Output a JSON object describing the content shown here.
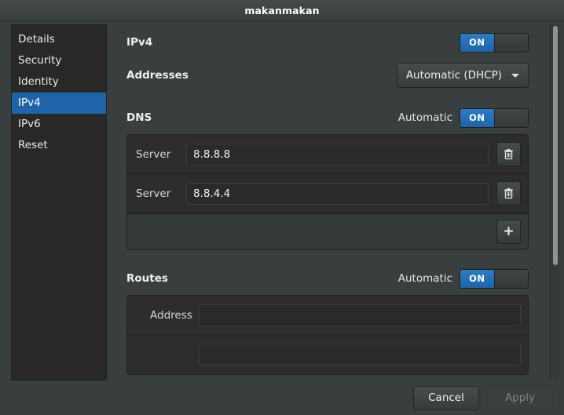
{
  "window": {
    "title": "makanmakan"
  },
  "sidebar": {
    "items": [
      {
        "label": "Details",
        "selected": false
      },
      {
        "label": "Security",
        "selected": false
      },
      {
        "label": "Identity",
        "selected": false
      },
      {
        "label": "IPv4",
        "selected": true
      },
      {
        "label": "IPv6",
        "selected": false
      },
      {
        "label": "Reset",
        "selected": false
      }
    ]
  },
  "main": {
    "ipv4": {
      "label": "IPv4",
      "toggle_state": "ON"
    },
    "addresses": {
      "label": "Addresses",
      "method": "Automatic (DHCP)"
    },
    "dns": {
      "label": "DNS",
      "automatic_label": "Automatic",
      "toggle_state": "ON",
      "servers": [
        {
          "field_label": "Server",
          "value": "8.8.8.8",
          "placeholder": ""
        },
        {
          "field_label": "Server",
          "value": "8.8.4.4",
          "placeholder": ""
        }
      ],
      "add_label": "+"
    },
    "routes": {
      "label": "Routes",
      "automatic_label": "Automatic",
      "toggle_state": "ON",
      "rows": [
        {
          "field_label": "Address",
          "value": "",
          "placeholder": ""
        }
      ]
    }
  },
  "footer": {
    "cancel_label": "Cancel",
    "apply_label": "Apply"
  },
  "colors": {
    "accent": "#1f64ab",
    "toggle_on": "#2471b8",
    "window_bg": "#393f3f",
    "sidebar_bg": "#282828"
  }
}
